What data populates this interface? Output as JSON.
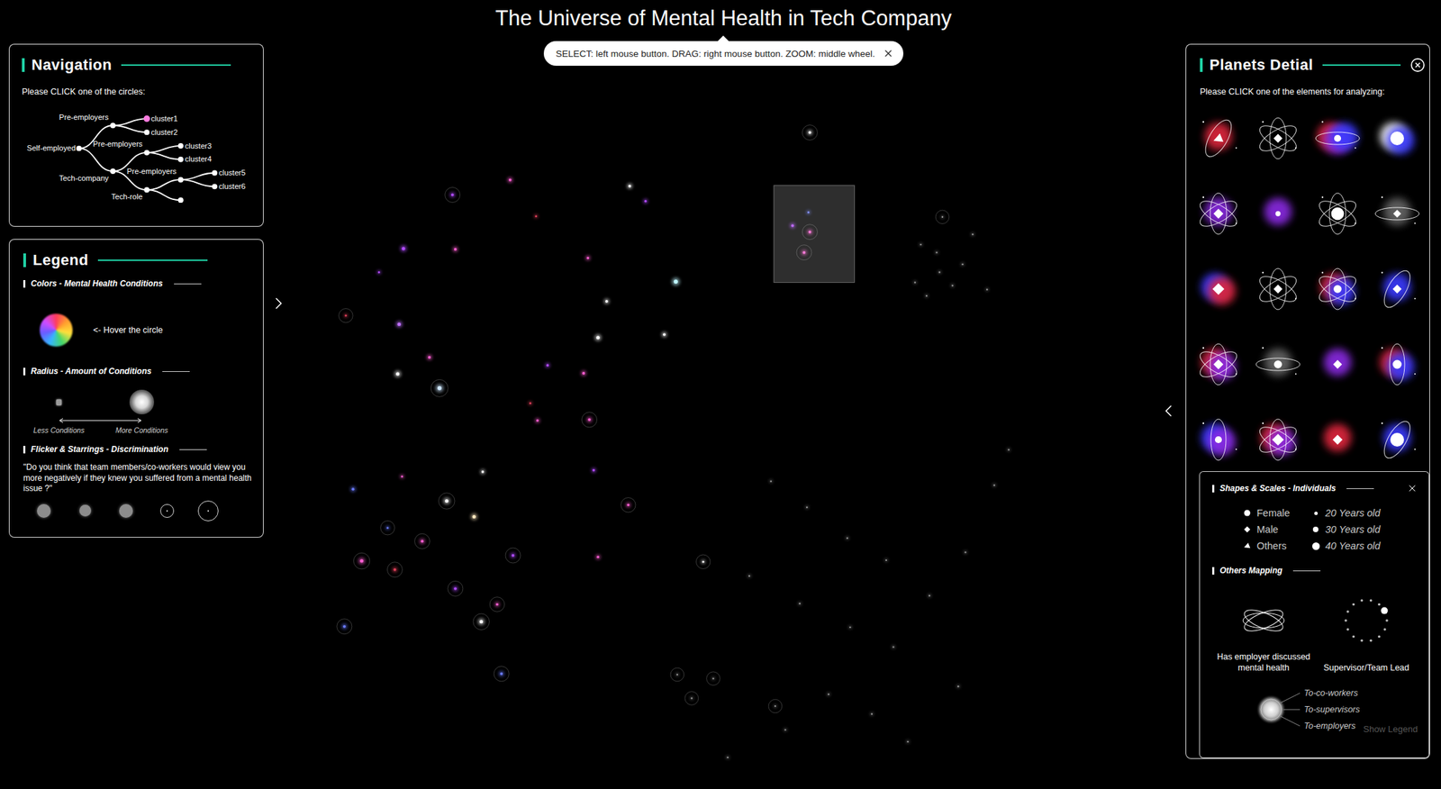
{
  "title": "The Universe of Mental Health in Tech Company",
  "hint": {
    "text": "SELECT: left mouse button. DRAG: right mouse button. ZOOM: middle wheel."
  },
  "navigation": {
    "title": "Navigation",
    "instruction": "Please CLICK one of the circles:",
    "tree": {
      "label": "Self-employed",
      "selected": false,
      "children": [
        {
          "label": "Pre-employers",
          "selected": false,
          "children": [
            {
              "label": "cluster1",
              "selected": true,
              "children": []
            },
            {
              "label": "cluster2",
              "selected": false,
              "children": []
            }
          ]
        },
        {
          "label": "Tech-company",
          "selected": false,
          "children": [
            {
              "label": "Pre-employers",
              "selected": false,
              "children": [
                {
                  "label": "cluster3",
                  "selected": false,
                  "children": []
                },
                {
                  "label": "cluster4",
                  "selected": false,
                  "children": []
                }
              ]
            },
            {
              "label": "Tech-role",
              "selected": false,
              "children": [
                {
                  "label": "Pre-employers",
                  "selected": false,
                  "children": [
                    {
                      "label": "cluster5",
                      "selected": false,
                      "children": []
                    },
                    {
                      "label": "cluster6",
                      "selected": false,
                      "children": []
                    }
                  ]
                },
                {
                  "label": "",
                  "selected": false,
                  "children": []
                }
              ]
            }
          ]
        }
      ]
    }
  },
  "legend": {
    "title": "Legend",
    "colors": {
      "heading": "Colors - Mental Health Conditions",
      "hint": "<- Hover the circle",
      "wheel": [
        "#ff3b5c",
        "#ff9f2e",
        "#ffe03b",
        "#45d86a",
        "#36b6ff",
        "#6a5cff",
        "#d04bff"
      ]
    },
    "radius": {
      "heading": "Radius - Amount of Conditions",
      "less": "Less Conditions",
      "more": "More Conditions"
    },
    "discrimination": {
      "heading": "Flicker & Starrings - Discrimination",
      "question": "\"Do you think that team members/co-workers would view you more negatively if they knew you suffered from a mental health issue ?\"",
      "marks": [
        {
          "kind": "fill",
          "level": 0.65
        },
        {
          "kind": "fill",
          "level": 0.55
        },
        {
          "kind": "fill",
          "level": 0.65
        },
        {
          "kind": "ring",
          "level": 0.65
        },
        {
          "kind": "ring",
          "level": 1
        }
      ]
    }
  },
  "planets": {
    "title": "Planets Detial",
    "instruction": "Please CLICK one of the elements for analyzing:",
    "items": [
      {
        "shape": "triangle",
        "orbit": "tilted",
        "glow": [
          "#e0263e"
        ],
        "level": 0.6
      },
      {
        "shape": "diamond",
        "orbit": "atom",
        "glow": [],
        "level": 0.5
      },
      {
        "shape": "circle",
        "orbit": "flat",
        "glow": [
          "#e0263e",
          "#8a2be2",
          "#3b3bff"
        ],
        "level": 0.3
      },
      {
        "shape": "circle",
        "orbit": "none",
        "glow": [
          "#ffffff",
          "#3b3bff"
        ],
        "level": 1
      },
      {
        "shape": "diamond",
        "orbit": "atom",
        "glow": [
          "#8a2be2"
        ],
        "level": 0.6
      },
      {
        "shape": "circle",
        "orbit": "none",
        "glow": [
          "#8a2be2"
        ],
        "level": 0.1
      },
      {
        "shape": "circle",
        "orbit": "atom",
        "glow": [],
        "level": 0.9
      },
      {
        "shape": "diamond",
        "orbit": "flat",
        "glow": [
          "#666666"
        ],
        "level": 0.4
      },
      {
        "shape": "diamond",
        "orbit": "none",
        "glow": [
          "#3b3bff",
          "#e0263e"
        ],
        "level": 0.8
      },
      {
        "shape": "diamond",
        "orbit": "atom",
        "glow": [],
        "level": 0.5
      },
      {
        "shape": "circle",
        "orbit": "atom",
        "glow": [
          "#e0263e",
          "#3b3bff"
        ],
        "level": 0.4
      },
      {
        "shape": "diamond",
        "orbit": "tilted",
        "glow": [
          "#3b3bff"
        ],
        "level": 0.5
      },
      {
        "shape": "diamond",
        "orbit": "atom",
        "glow": [
          "#e0263e",
          "#8a2be2"
        ],
        "level": 0.6
      },
      {
        "shape": "circle",
        "orbit": "flat",
        "glow": [
          "#666666"
        ],
        "level": 0.4
      },
      {
        "shape": "diamond",
        "orbit": "none",
        "glow": [
          "#8a2be2"
        ],
        "level": 0.5
      },
      {
        "shape": "circle",
        "orbit": "vertical",
        "glow": [
          "#e0263e",
          "#3b3bff"
        ],
        "level": 0.5
      },
      {
        "shape": "circle",
        "orbit": "vertical",
        "glow": [
          "#3b3bff",
          "#8a2be2"
        ],
        "level": 0.3
      },
      {
        "shape": "diamond",
        "orbit": "atom",
        "glow": [
          "#e0263e",
          "#8a2be2"
        ],
        "level": 0.8
      },
      {
        "shape": "diamond",
        "orbit": "none",
        "glow": [
          "#e0263e"
        ],
        "level": 0.6
      },
      {
        "shape": "circle",
        "orbit": "tilted",
        "glow": [
          "#3b3bff"
        ],
        "level": 1
      }
    ]
  },
  "individuals": {
    "title": "Shapes & Scales - Individuals",
    "genders": [
      {
        "label": "Female",
        "shape": "circle"
      },
      {
        "label": "Male",
        "shape": "diamond"
      },
      {
        "label": "Others",
        "shape": "triangle"
      }
    ],
    "ages": [
      {
        "label": "20 Years old",
        "level": 0.2
      },
      {
        "label": "30 Years old",
        "level": 0.5
      },
      {
        "label": "40 Years old",
        "level": 0.8
      }
    ],
    "mappingTitle": "Others Mapping",
    "discussed": "Has employer discussed mental health",
    "supervisor": "Supervisor/Team Lead",
    "rings": [
      "To-co-workers",
      "To-supervisors",
      "To-employers"
    ],
    "showLegend": "Show Legend"
  },
  "universe": {
    "selection": {
      "x0": 53.7,
      "x1": 59.3,
      "y0": 23.5,
      "y1": 35.8
    },
    "points": [
      {
        "x": 28.0,
        "y": 31.5,
        "r": 2.5,
        "color": "#b04bff",
        "ring": false
      },
      {
        "x": 31.6,
        "y": 31.6,
        "r": 2,
        "color": "#ff5fd2",
        "ring": false
      },
      {
        "x": 27.7,
        "y": 41.1,
        "r": 2.5,
        "color": "#c070ff",
        "ring": false
      },
      {
        "x": 27.6,
        "y": 47.4,
        "r": 2.5,
        "color": "#ffffff",
        "ring": false
      },
      {
        "x": 30.5,
        "y": 49.2,
        "r": 3,
        "color": "#cfe8ff",
        "ring": true
      },
      {
        "x": 29.8,
        "y": 45.3,
        "r": 2,
        "color": "#ff5fd2",
        "ring": false
      },
      {
        "x": 41.5,
        "y": 42.8,
        "r": 2.5,
        "color": "#ffffff",
        "ring": false
      },
      {
        "x": 46.9,
        "y": 35.7,
        "r": 3,
        "color": "#bff6ff",
        "ring": false
      },
      {
        "x": 46.1,
        "y": 42.4,
        "r": 2,
        "color": "#ffffff",
        "ring": false
      },
      {
        "x": 35.4,
        "y": 22.8,
        "r": 2,
        "color": "#ff5fd2",
        "ring": false
      },
      {
        "x": 43.7,
        "y": 23.6,
        "r": 2,
        "color": "#ffffff",
        "ring": false
      },
      {
        "x": 44.8,
        "y": 25.5,
        "r": 1.8,
        "color": "#b04bff",
        "ring": false
      },
      {
        "x": 40.8,
        "y": 32.7,
        "r": 1.8,
        "color": "#ff5fd2",
        "ring": false
      },
      {
        "x": 42.1,
        "y": 38.2,
        "r": 2,
        "color": "#ffffff",
        "ring": false
      },
      {
        "x": 38.0,
        "y": 46.3,
        "r": 1.8,
        "color": "#b04bff",
        "ring": false
      },
      {
        "x": 40.5,
        "y": 47.3,
        "r": 2,
        "color": "#ff5fd2",
        "ring": false
      },
      {
        "x": 31.0,
        "y": 63.5,
        "r": 2.5,
        "color": "#ffffff",
        "ring": true
      },
      {
        "x": 32.9,
        "y": 65.5,
        "r": 2.5,
        "color": "#ffe9c0",
        "ring": false
      },
      {
        "x": 35.6,
        "y": 70.4,
        "r": 2,
        "color": "#b04bff",
        "ring": true
      },
      {
        "x": 29.3,
        "y": 68.6,
        "r": 2,
        "color": "#ff5fd2",
        "ring": true
      },
      {
        "x": 25.1,
        "y": 71.1,
        "r": 2.5,
        "color": "#ff5fd2",
        "ring": true
      },
      {
        "x": 27.4,
        "y": 72.2,
        "r": 2,
        "color": "#e0405a",
        "ring": true
      },
      {
        "x": 23.9,
        "y": 79.4,
        "r": 2,
        "color": "#6a7bff",
        "ring": true
      },
      {
        "x": 24.5,
        "y": 62.0,
        "r": 2,
        "color": "#6a7bff",
        "ring": false
      },
      {
        "x": 27.9,
        "y": 60.4,
        "r": 1.5,
        "color": "#ff5fd2",
        "ring": false
      },
      {
        "x": 33.4,
        "y": 78.8,
        "r": 2.5,
        "color": "#ffffff",
        "ring": true
      },
      {
        "x": 34.8,
        "y": 85.4,
        "r": 2,
        "color": "#6a7bff",
        "ring": true
      },
      {
        "x": 34.5,
        "y": 76.6,
        "r": 1.8,
        "color": "#ff5fd2",
        "ring": true
      },
      {
        "x": 31.6,
        "y": 74.6,
        "r": 2,
        "color": "#b04bff",
        "ring": true
      },
      {
        "x": 37.3,
        "y": 53.3,
        "r": 1.8,
        "color": "#ff5fd2",
        "ring": false
      },
      {
        "x": 41.2,
        "y": 59.6,
        "r": 1.8,
        "color": "#b04bff",
        "ring": false
      },
      {
        "x": 43.6,
        "y": 64.0,
        "r": 1.8,
        "color": "#ff5fd2",
        "ring": true
      },
      {
        "x": 40.9,
        "y": 53.2,
        "r": 2,
        "color": "#ff5fd2",
        "ring": true
      },
      {
        "x": 24.0,
        "y": 40.0,
        "r": 1.5,
        "color": "#e0405a",
        "ring": true
      },
      {
        "x": 26.3,
        "y": 34.5,
        "r": 1.5,
        "color": "#b04bff",
        "ring": false
      },
      {
        "x": 36.8,
        "y": 51.1,
        "r": 1.5,
        "color": "#e0405a",
        "ring": false
      },
      {
        "x": 37.2,
        "y": 27.4,
        "r": 1.5,
        "color": "#e0405a",
        "ring": false
      },
      {
        "x": 33.5,
        "y": 59.8,
        "r": 1.8,
        "color": "#ffffff",
        "ring": false
      },
      {
        "x": 41.5,
        "y": 70.6,
        "r": 1.8,
        "color": "#ff5fd2",
        "ring": false
      },
      {
        "x": 26.9,
        "y": 66.9,
        "r": 1.5,
        "color": "#6a7bff",
        "ring": true
      },
      {
        "x": 55.0,
        "y": 28.6,
        "r": 2,
        "color": "#b04bff",
        "ring": false
      },
      {
        "x": 56.2,
        "y": 29.4,
        "r": 2,
        "color": "#ff5fd2",
        "ring": true
      },
      {
        "x": 55.8,
        "y": 32.0,
        "r": 2,
        "color": "#ff5fd2",
        "ring": true
      },
      {
        "x": 56.1,
        "y": 26.9,
        "r": 1.5,
        "color": "#6a7bff",
        "ring": false
      },
      {
        "x": 56.2,
        "y": 16.8,
        "r": 2,
        "color": "#ffffff",
        "ring": true
      },
      {
        "x": 31.4,
        "y": 24.7,
        "r": 2,
        "color": "#b04bff",
        "ring": true
      },
      {
        "x": 48.8,
        "y": 71.2,
        "r": 1.5,
        "color": "#ffffff",
        "ring": true
      },
      {
        "x": 63.5,
        "y": 35.8,
        "r": 1.2,
        "color": "#9a9a9a",
        "ring": false
      },
      {
        "x": 64.3,
        "y": 37.5,
        "r": 1.2,
        "color": "#9a9a9a",
        "ring": false
      },
      {
        "x": 65.2,
        "y": 34.5,
        "r": 1.2,
        "color": "#9a9a9a",
        "ring": false
      },
      {
        "x": 66.1,
        "y": 36.2,
        "r": 1.2,
        "color": "#9a9a9a",
        "ring": false
      },
      {
        "x": 65.0,
        "y": 32.0,
        "r": 1.2,
        "color": "#9a9a9a",
        "ring": false
      },
      {
        "x": 66.8,
        "y": 33.5,
        "r": 1.2,
        "color": "#9a9a9a",
        "ring": false
      },
      {
        "x": 67.5,
        "y": 29.7,
        "r": 1.2,
        "color": "#9a9a9a",
        "ring": false
      },
      {
        "x": 63.9,
        "y": 31.0,
        "r": 1.2,
        "color": "#9a9a9a",
        "ring": false
      },
      {
        "x": 68.5,
        "y": 36.7,
        "r": 1.2,
        "color": "#9a9a9a",
        "ring": false
      },
      {
        "x": 65.4,
        "y": 27.5,
        "r": 1.2,
        "color": "#9a9a9a",
        "ring": true
      },
      {
        "x": 53.5,
        "y": 61.0,
        "r": 1.2,
        "color": "#9a9a9a",
        "ring": false
      },
      {
        "x": 56.0,
        "y": 64.3,
        "r": 1.2,
        "color": "#9a9a9a",
        "ring": false
      },
      {
        "x": 58.8,
        "y": 68.2,
        "r": 1.2,
        "color": "#9a9a9a",
        "ring": false
      },
      {
        "x": 61.5,
        "y": 71.0,
        "r": 1.2,
        "color": "#9a9a9a",
        "ring": false
      },
      {
        "x": 52.0,
        "y": 73.0,
        "r": 1.2,
        "color": "#9a9a9a",
        "ring": false
      },
      {
        "x": 55.5,
        "y": 76.5,
        "r": 1.2,
        "color": "#9a9a9a",
        "ring": false
      },
      {
        "x": 59.0,
        "y": 79.5,
        "r": 1.2,
        "color": "#9a9a9a",
        "ring": false
      },
      {
        "x": 62.0,
        "y": 82.0,
        "r": 1.2,
        "color": "#9a9a9a",
        "ring": false
      },
      {
        "x": 64.5,
        "y": 75.5,
        "r": 1.2,
        "color": "#9a9a9a",
        "ring": false
      },
      {
        "x": 67.0,
        "y": 70.0,
        "r": 1.2,
        "color": "#9a9a9a",
        "ring": false
      },
      {
        "x": 69.0,
        "y": 61.5,
        "r": 1.2,
        "color": "#9a9a9a",
        "ring": false
      },
      {
        "x": 70.0,
        "y": 57.0,
        "r": 1.2,
        "color": "#9a9a9a",
        "ring": false
      },
      {
        "x": 57.5,
        "y": 88.0,
        "r": 1.2,
        "color": "#9a9a9a",
        "ring": false
      },
      {
        "x": 60.5,
        "y": 90.5,
        "r": 1.2,
        "color": "#9a9a9a",
        "ring": false
      },
      {
        "x": 54.5,
        "y": 92.5,
        "r": 1.2,
        "color": "#9a9a9a",
        "ring": false
      },
      {
        "x": 49.5,
        "y": 86.0,
        "r": 1.2,
        "color": "#9a9a9a",
        "ring": true
      },
      {
        "x": 47.0,
        "y": 85.5,
        "r": 1.2,
        "color": "#9a9a9a",
        "ring": true
      },
      {
        "x": 48.0,
        "y": 88.5,
        "r": 1.2,
        "color": "#9a9a9a",
        "ring": true
      },
      {
        "x": 53.8,
        "y": 89.5,
        "r": 1.2,
        "color": "#9a9a9a",
        "ring": true
      },
      {
        "x": 63.0,
        "y": 94.0,
        "r": 1.2,
        "color": "#9a9a9a",
        "ring": false
      },
      {
        "x": 66.5,
        "y": 87.0,
        "r": 1.2,
        "color": "#9a9a9a",
        "ring": false
      },
      {
        "x": 50.5,
        "y": 96.0,
        "r": 1.2,
        "color": "#9a9a9a",
        "ring": false
      }
    ]
  }
}
